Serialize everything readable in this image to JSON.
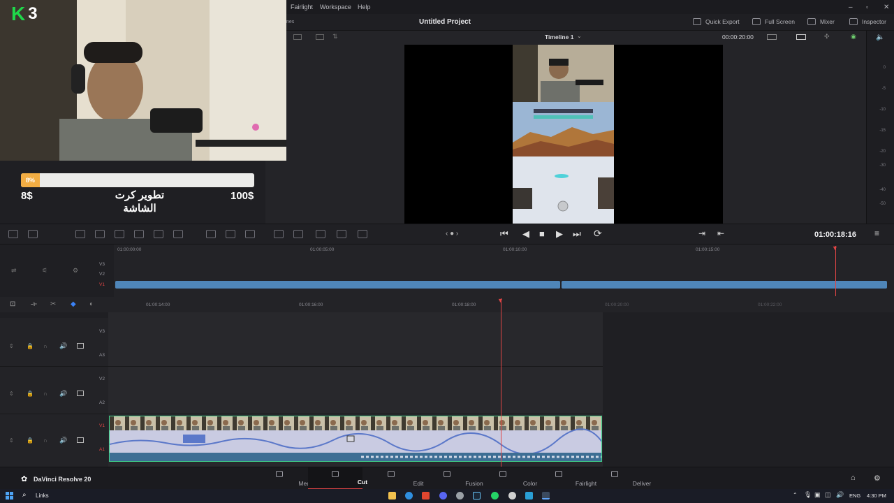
{
  "menu": {
    "items": [
      "Fairlight",
      "Workspace",
      "Help"
    ],
    "partial_left": "nes"
  },
  "title_bar": {
    "project_title": "Untitled Project",
    "actions": [
      {
        "label": "Quick Export",
        "icon": "export-icon"
      },
      {
        "label": "Full Screen",
        "icon": "fullscreen-icon"
      },
      {
        "label": "Mixer",
        "icon": "mixer-icon"
      },
      {
        "label": "Inspector",
        "icon": "inspector-icon"
      }
    ]
  },
  "viewer": {
    "timeline_name": "Timeline 1",
    "duration": "00:00:20:00"
  },
  "audio_meter": {
    "labels": [
      "0",
      "-5",
      "-10",
      "-15",
      "-20",
      "-30",
      "-40",
      "-50"
    ]
  },
  "overlay": {
    "badge_letter": "K",
    "badge_number": "3",
    "progress_percent": 8,
    "progress_label": "8%",
    "goal_min": "8$",
    "goal_max": "100$",
    "goal_title": "تطوير كرت الشاشة"
  },
  "transport": {
    "timecode": "01:00:18:16"
  },
  "upper_timeline": {
    "ruler": [
      "01:00:00:00",
      "01:00:05:00",
      "01:00:10:00",
      "01:00:15:00"
    ],
    "tracks": [
      "V3",
      "V2",
      "V1"
    ]
  },
  "lower_timeline": {
    "ruler": [
      "01:00:14:00",
      "01:00:16:00",
      "01:00:18:00",
      "01:00:20:00",
      "01:00:22:00"
    ],
    "tracks": [
      {
        "video": "V3",
        "audio": "A3"
      },
      {
        "video": "V2",
        "audio": "A2"
      },
      {
        "video": "V1",
        "audio": "A1"
      }
    ]
  },
  "app_name": "DaVinci Resolve 20",
  "pages": [
    {
      "label": "Media",
      "active": false
    },
    {
      "label": "Cut",
      "active": true
    },
    {
      "label": "Edit",
      "active": false
    },
    {
      "label": "Fusion",
      "active": false
    },
    {
      "label": "Color",
      "active": false
    },
    {
      "label": "Fairlight",
      "active": false
    },
    {
      "label": "Deliver",
      "active": false
    }
  ],
  "taskbar": {
    "search_label": "Links",
    "language": "ENG",
    "time": "4:30 PM"
  },
  "colors": {
    "accent_red": "#e04545",
    "clip_blue": "#4f86b9",
    "progress_orange": "#f2ad43",
    "badge_green": "#1fd84a"
  }
}
